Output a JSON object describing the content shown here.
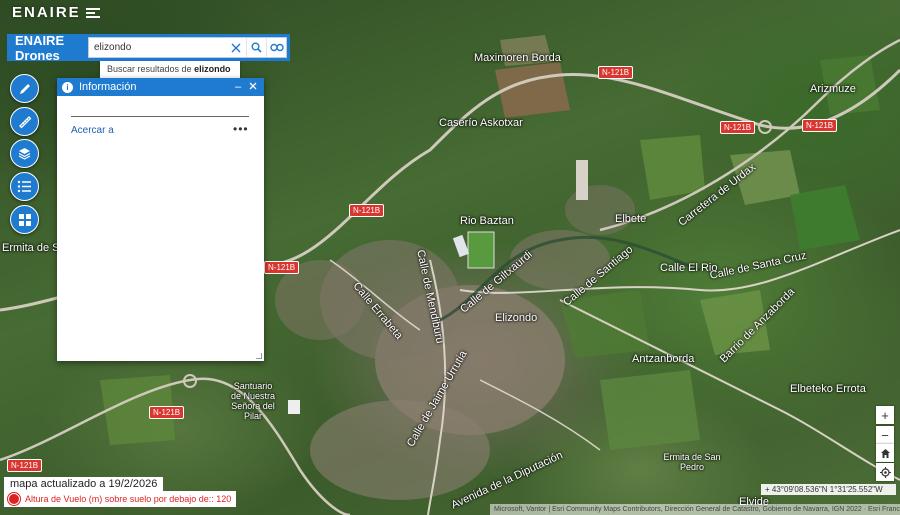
{
  "brand": {
    "logo_text": "ENAIRE"
  },
  "search": {
    "app_title": "ENAIRE Drones",
    "value": "elizondo",
    "suggestion_prefix": "Buscar resultados de",
    "suggestion_term": "elizondo"
  },
  "tools": [
    {
      "name": "draw-pencil-button",
      "icon": "pencil-icon"
    },
    {
      "name": "measure-ruler-button",
      "icon": "ruler-icon"
    },
    {
      "name": "layers-button",
      "icon": "layers-icon"
    },
    {
      "name": "legend-list-button",
      "icon": "list-icon"
    },
    {
      "name": "basemap-gallery-button",
      "icon": "grid-icon"
    }
  ],
  "info_panel": {
    "title": "Información",
    "zoom_link": "Acercar a",
    "more": "•••"
  },
  "map": {
    "labels": [
      {
        "text": "Maximoren Borda",
        "cls": "tiny"
      },
      {
        "text": "Caserío Askotxar",
        "cls": "tiny"
      },
      {
        "text": "Arizmuze",
        "cls": "tiny"
      },
      {
        "text": "Ermita de San Marcial",
        "cls": "tiny"
      },
      {
        "text": "Elbete",
        "cls": "big"
      },
      {
        "text": "Elizondo",
        "cls": "big"
      },
      {
        "text": "Antzanborda",
        "cls": "big"
      },
      {
        "text": "Rio Baztan",
        "cls": "tiny"
      },
      {
        "text": "Calle de Santiago",
        "cls": ""
      },
      {
        "text": "Calle de Giltxaurdi",
        "cls": ""
      },
      {
        "text": "Calle El Rio",
        "cls": ""
      },
      {
        "text": "Calle de Santa Cruz",
        "cls": ""
      },
      {
        "text": "Carretera de Urdax",
        "cls": ""
      },
      {
        "text": "Calle Errabeta",
        "cls": ""
      },
      {
        "text": "Calle de Mendiburu",
        "cls": ""
      },
      {
        "text": "Barrio de Anzaborda",
        "cls": ""
      },
      {
        "text": "Avenida de la Diputación",
        "cls": ""
      },
      {
        "text": "Calle de Jaime Urrutia",
        "cls": ""
      },
      {
        "text": "Santuario de Nuestra Señora del Pilar",
        "cls": "tiny"
      },
      {
        "text": "Ermita de San Pedro",
        "cls": "tiny"
      },
      {
        "text": "Elbeteko Errota",
        "cls": "tiny"
      },
      {
        "text": "Elvide",
        "cls": ""
      }
    ],
    "road_badges": [
      "N-121B",
      "N-121B",
      "N-121B",
      "N-121B",
      "N-121B",
      "N-121B",
      "N-121B"
    ]
  },
  "controls": {
    "zoom_in": "+",
    "zoom_out": "−",
    "home": "home-icon",
    "locate": "locate-icon",
    "coordinates": "43°09'08.536\"N 1°31'25.552\"W",
    "attribution": "Microsoft, Vantor | Esri Community Maps Contributors, Dirección General de Catastro, Gobierno de Navarra, IGN 2022 · Esri France"
  },
  "status": {
    "updated_label": "mapa actualizado a",
    "updated_date": "19/2/2026",
    "legend_text": "Altura de Vuelo (m) sobre suelo por debajo de:: 120"
  },
  "colors": {
    "accent": "#1f7bd0",
    "road_badge": "#d9362f",
    "legend_red": "#d22"
  }
}
